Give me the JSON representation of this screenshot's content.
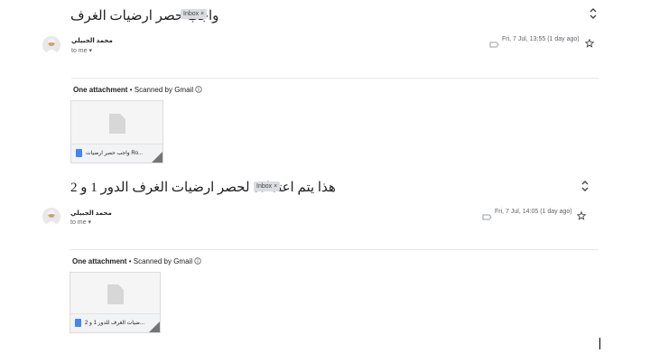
{
  "threads": [
    {
      "subject": "واجب حصر ارضيات الغرف",
      "label": "Inbox",
      "label_close": "×",
      "sender": "محمد الجبيلي",
      "recipient": "to me",
      "date": "Fri, 7 Jul, 13:55 (1 day ago)",
      "attachments_heading": "One attachment",
      "scan_note": "• Scanned by Gmail",
      "attachment_name": "واجب حصر ارضيات Ro..."
    },
    {
      "subject": "هذا يتم اعتماده لحصر ارضيات الغرف الدور 1 و 2",
      "label": "Inbox",
      "label_close": "×",
      "sender": "محمد الجبيلي",
      "recipient": "to me",
      "date": "Fri, 7 Jul, 14:05 (1 day ago)",
      "attachments_heading": "One attachment",
      "scan_note": "• Scanned by Gmail",
      "attachment_name": "ضيات الغرف للدور 1 و 2..."
    }
  ],
  "icons": {
    "expand": "unfold-icon",
    "star": "star-icon",
    "label": "label-icon",
    "info": "info-icon",
    "dropdown": "chevron-down-icon"
  },
  "colors": {
    "file_icon": "#4285f4",
    "badge_bg": "#dadce0"
  }
}
